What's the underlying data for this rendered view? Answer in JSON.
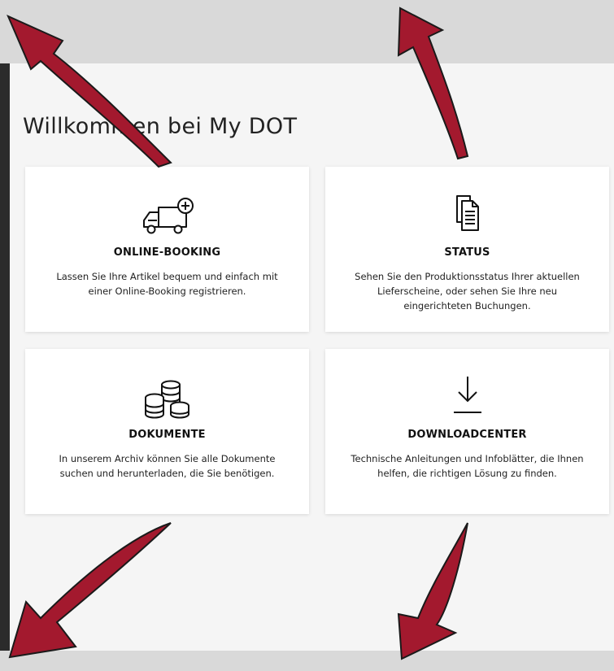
{
  "page": {
    "title": "Willkommen bei My DOT"
  },
  "cards": [
    {
      "title": "ONLINE-BOOKING",
      "description": "Lassen Sie Ihre Artikel bequem und einfach mit einer Online-Booking registrieren.",
      "icon": "truck-plus-icon"
    },
    {
      "title": "STATUS",
      "description": "Sehen Sie den Produktionsstatus Ihrer aktuellen Lieferscheine, oder sehen Sie Ihre neu eingerichteten Buchungen.",
      "icon": "documents-icon"
    },
    {
      "title": "DOKUMENTE",
      "description": "In unserem Archiv können Sie alle Dokumente suchen und herunterladen, die Sie benötigen.",
      "icon": "coins-stack-icon"
    },
    {
      "title": "DOWNLOADCENTER",
      "description": "Technische Anleitungen und Infoblätter, die Ihnen helfen, die richtigen Lösung zu finden.",
      "icon": "download-icon"
    }
  ],
  "colors": {
    "arrow": "#a3192e",
    "sidebar": "#2b2b2b",
    "panel": "#f5f5f5",
    "backdrop": "#d9d9d9"
  }
}
